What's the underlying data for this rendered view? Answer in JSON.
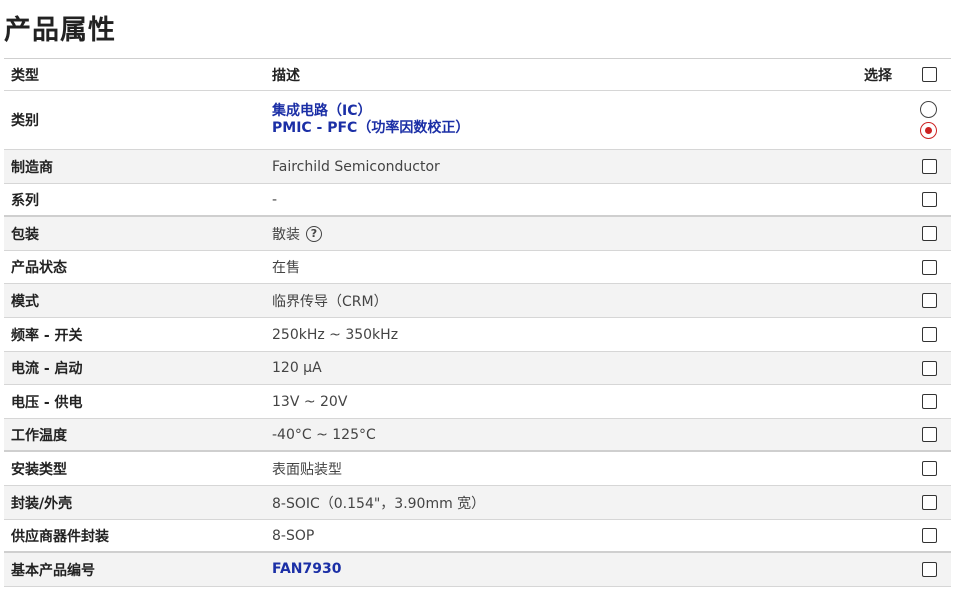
{
  "page": {
    "title": "产品属性"
  },
  "header": {
    "type": "类型",
    "desc": "描述",
    "select": "选择"
  },
  "category": {
    "label": "类别",
    "links": [
      "集成电路（IC）",
      "PMIC - PFC（功率因数校正）"
    ]
  },
  "rows": [
    {
      "label": "制造商",
      "value": "Fairchild Semiconductor"
    },
    {
      "label": "系列",
      "value": "-"
    },
    {
      "label": "包装",
      "value": "散装",
      "help_icon": "question-circle-icon"
    },
    {
      "label": "产品状态",
      "value": "在售"
    },
    {
      "label": "模式",
      "value": "临界传导（CRM）"
    },
    {
      "label": "频率 - 开关",
      "value": "250kHz ~ 350kHz"
    },
    {
      "label": "电流 - 启动",
      "value": "120 µA"
    },
    {
      "label": "电压 - 供电",
      "value": "13V ~ 20V"
    },
    {
      "label": "工作温度",
      "value": "-40°C ~ 125°C"
    },
    {
      "label": "安装类型",
      "value": "表面贴装型"
    },
    {
      "label": "封装/外壳",
      "value": "8-SOIC（0.154\"，3.90mm 宽）"
    },
    {
      "label": "供应商器件封装",
      "value": "8-SOP"
    },
    {
      "label": "基本产品编号",
      "value": "FAN7930",
      "is_link": true
    }
  ],
  "colors": {
    "link": "#1b2fa6",
    "radio_selected": "#cc2222",
    "row_alt": "#f3f3f3"
  }
}
